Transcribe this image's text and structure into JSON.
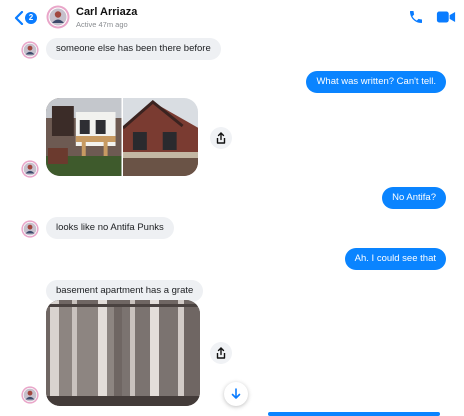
{
  "header": {
    "unread_count": "2",
    "contact_name": "Carl Arriaza",
    "status": "Active 47m ago",
    "accent": "#0a7cff"
  },
  "messages": [
    {
      "side": "in",
      "text": "someone else has been there before"
    },
    {
      "side": "out",
      "text": "What was written?  Can't tell."
    },
    {
      "side": "in",
      "type": "photos",
      "count": 2
    },
    {
      "side": "out",
      "text": "No Antifa?"
    },
    {
      "side": "in",
      "text": "looks like no Antifa Punks"
    },
    {
      "side": "out",
      "text": "Ah. I could see that"
    },
    {
      "side": "in",
      "text": "basement apartment has a grate"
    },
    {
      "side": "in",
      "type": "photo",
      "count": 1
    }
  ],
  "icons": {
    "back": "chevron-left-icon",
    "call": "phone-icon",
    "video": "video-camera-icon",
    "share": "share-icon",
    "scroll": "arrow-down-icon"
  },
  "colors": {
    "incoming_bubble": "#eef0f3",
    "outgoing_bubble": "#0a84ff"
  }
}
